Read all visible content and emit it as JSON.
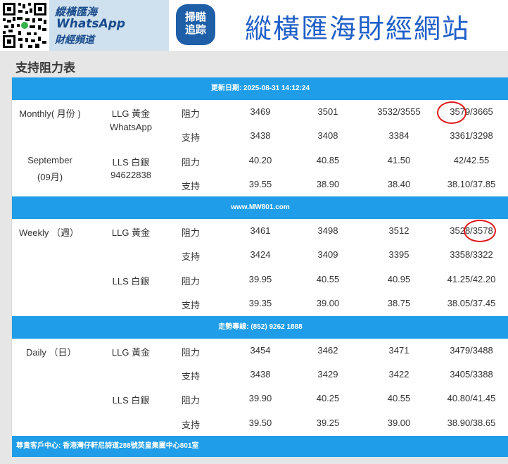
{
  "banner": {
    "brand_line1": "縱橫匯海",
    "brand_line2": "WhatsApp",
    "brand_line3": "財經頻道",
    "scan_line1": "掃瞄",
    "scan_line2": "追踪",
    "site_title": "縱橫匯海財經網站"
  },
  "panel_title": "支持阻力表",
  "bands": {
    "update": "更新日期: 2025-08-31 14:12:24",
    "site": "www.MW801.com",
    "hotline": "走勢專線: (852) 9262 1888",
    "footer": "尊貴客戶中心: 香港灣仔軒尼詩道288號英皇集團中心801室"
  },
  "monthly": {
    "term": "Monthly( 月份 )",
    "month": "September",
    "month_num": "(09月)",
    "contact1": "WhatsApp",
    "contact2": "94622838",
    "gold": {
      "name": "LLG 黃金",
      "res": [
        "3469",
        "3501",
        "3532/3555",
        "3579/3665"
      ],
      "sup": [
        "3438",
        "3408",
        "3384",
        "3361/3298"
      ]
    },
    "silver": {
      "name": "LLS 白銀",
      "res": [
        "40.20",
        "40.85",
        "41.50",
        "42/42.55"
      ],
      "sup": [
        "39.55",
        "38.90",
        "38.40",
        "38.10/37.85"
      ]
    }
  },
  "weekly": {
    "term": "Weekly （週）",
    "gold": {
      "name": "LLG 黃金",
      "res": [
        "3461",
        "3498",
        "3512",
        "3528/3578"
      ],
      "sup": [
        "3424",
        "3409",
        "3395",
        "3358/3322"
      ]
    },
    "silver": {
      "name": "LLS 白銀",
      "res": [
        "39.95",
        "40.55",
        "40.95",
        "41.25/42.20"
      ],
      "sup": [
        "39.35",
        "39.00",
        "38.75",
        "38.05/37.45"
      ]
    }
  },
  "daily": {
    "term": "Daily （日）",
    "gold": {
      "name": "LLG 黃金",
      "res": [
        "3454",
        "3462",
        "3471",
        "3479/3488"
      ],
      "sup": [
        "3438",
        "3429",
        "3422",
        "3405/3388"
      ]
    },
    "silver": {
      "name": "LLS 白銀",
      "res": [
        "39.90",
        "40.25",
        "40.55",
        "40.80/41.45"
      ],
      "sup": [
        "39.50",
        "39.25",
        "39.00",
        "38.90/38.65"
      ]
    }
  },
  "labels": {
    "resistance": "阻力",
    "support": "支持"
  },
  "colors": {
    "band_blue": "#1f9de8",
    "title_blue": "#1f5fc8",
    "circle_red": "#e01b1b"
  }
}
